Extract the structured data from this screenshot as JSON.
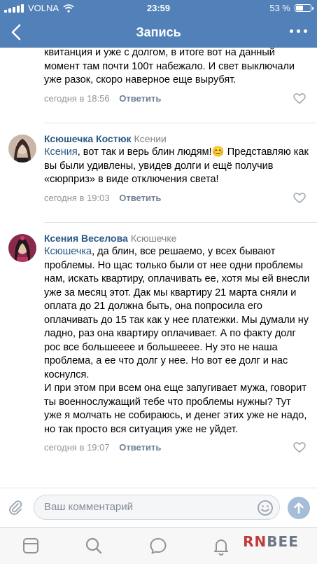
{
  "status_bar": {
    "carrier": "VOLNA",
    "time": "23:59",
    "battery_text": "53 %",
    "battery_level": 0.53
  },
  "header": {
    "title": "Запись"
  },
  "comments": [
    {
      "author": "",
      "reply_to": "",
      "mention": "",
      "text": "квитанция и уже с долгом, в итоге вот на данный момент там почти 100т набежало. И свет выключали уже разок, скоро наверное еще вырубят.",
      "date": "сегодня в 18:56",
      "answer_label": "Ответить"
    },
    {
      "author": "Ксюшечка Костюк",
      "reply_to": "Ксении",
      "mention": "Ксения",
      "text": ", вот так и верь блин людям!😊 Представляю как вы были удивлены, увидев долги и ещё получив «сюрприз» в виде отключения света!",
      "date": "сегодня в 19:03",
      "answer_label": "Ответить"
    },
    {
      "author": "Ксения Веселова",
      "reply_to": "Ксюшечке",
      "mention": "Ксюшечка",
      "text": ", да блин, все решаемо, у всех бывают проблемы. Но щас только были от нее одни проблемы нам, искать квартиру, оплачивать ее, хотя мы ей внесли уже за месяц этот. Дак мы квартиру 21 марта сняли и оплата до 21 должна быть, она попросила его оплачивать до 15 так как у нее платежки. Мы думали ну ладно, раз она квартиру оплачивает. А по факту долг рос все большееее и большееее. Ну это не наша проблема, а ее что долг у нее. Но вот ее долг и нас коснулся.",
      "text2": "И при этом при всем она еще запугивает мужа, говорит ты военнослужащий тебе что проблемы нужны? Тут уже я молчать не собираюсь, и денег этих уже не надо, но так просто вся ситуация уже не уйдет.",
      "date": "сегодня в 19:07",
      "answer_label": "Ответить"
    }
  ],
  "comment_input": {
    "placeholder": "Ваш комментарий"
  },
  "watermark": {
    "part1": "RN",
    "part2": "BEE"
  },
  "icons": {
    "back": "chevron-left-icon",
    "more": "more-dots-icon",
    "like": "heart-outline-icon",
    "attach": "paperclip-icon",
    "emoji": "smile-icon",
    "send": "send-arrow-icon",
    "tabs": [
      "news-feed-icon",
      "search-icon",
      "messages-icon",
      "notifications-bell-icon"
    ]
  },
  "colors": {
    "header": "#5181b8",
    "link": "#2a5885",
    "meta": "#939393",
    "answer": "#6d7f93"
  }
}
